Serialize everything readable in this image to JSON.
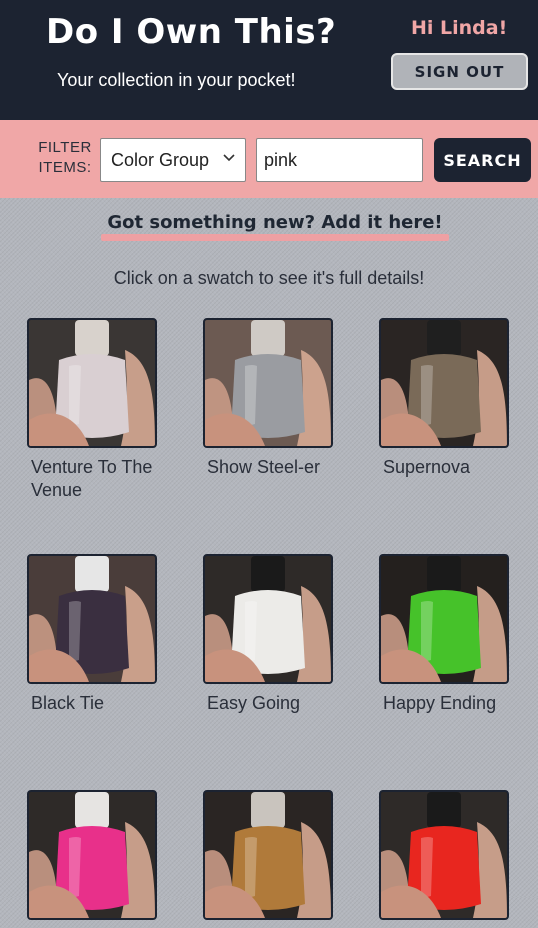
{
  "header": {
    "title": "Do I Own This?",
    "tagline": "Your collection in your pocket!",
    "greeting": "Hi Linda!",
    "signout_label": "SIGN OUT"
  },
  "filter": {
    "label": "FILTER ITEMS:",
    "select_value": "Color Group",
    "search_value": "pink",
    "search_label": "SEARCH"
  },
  "main": {
    "add_link": "Got something new? Add it here!",
    "hint": "Click on a swatch to see it's full details!"
  },
  "swatches": [
    {
      "name": "Venture To The Venue",
      "color": "#d9cfd2",
      "cap": "#d8d2cc",
      "bg": "#3a3634"
    },
    {
      "name": "Show Steel-er",
      "color": "#9a9ca1",
      "cap": "#cfcac5",
      "bg": "#6c5a52"
    },
    {
      "name": "Supernova",
      "color": "#7a6a58",
      "cap": "#1f1f1f",
      "bg": "#2a2523"
    },
    {
      "name": "Black Tie",
      "color": "#3a2f40",
      "cap": "#e6e6e6",
      "bg": "#4a3d3a"
    },
    {
      "name": "Easy Going",
      "color": "#ecebe8",
      "cap": "#1a1a1a",
      "bg": "#2e2a28"
    },
    {
      "name": "Happy Ending",
      "color": "#46c22a",
      "cap": "#1a1a1a",
      "bg": "#24201e"
    },
    {
      "name": "",
      "color": "#e8308a",
      "cap": "#e6e4e2",
      "bg": "#2e2a28"
    },
    {
      "name": "",
      "color": "#b07a3a",
      "cap": "#c9c4be",
      "bg": "#2a2523"
    },
    {
      "name": "",
      "color": "#e8261f",
      "cap": "#1a1a1a",
      "bg": "#2e2a28"
    }
  ],
  "colors": {
    "header_bg": "#1c2331",
    "accent_pink": "#f0a7a7",
    "page_bg": "#b3b6bd"
  }
}
